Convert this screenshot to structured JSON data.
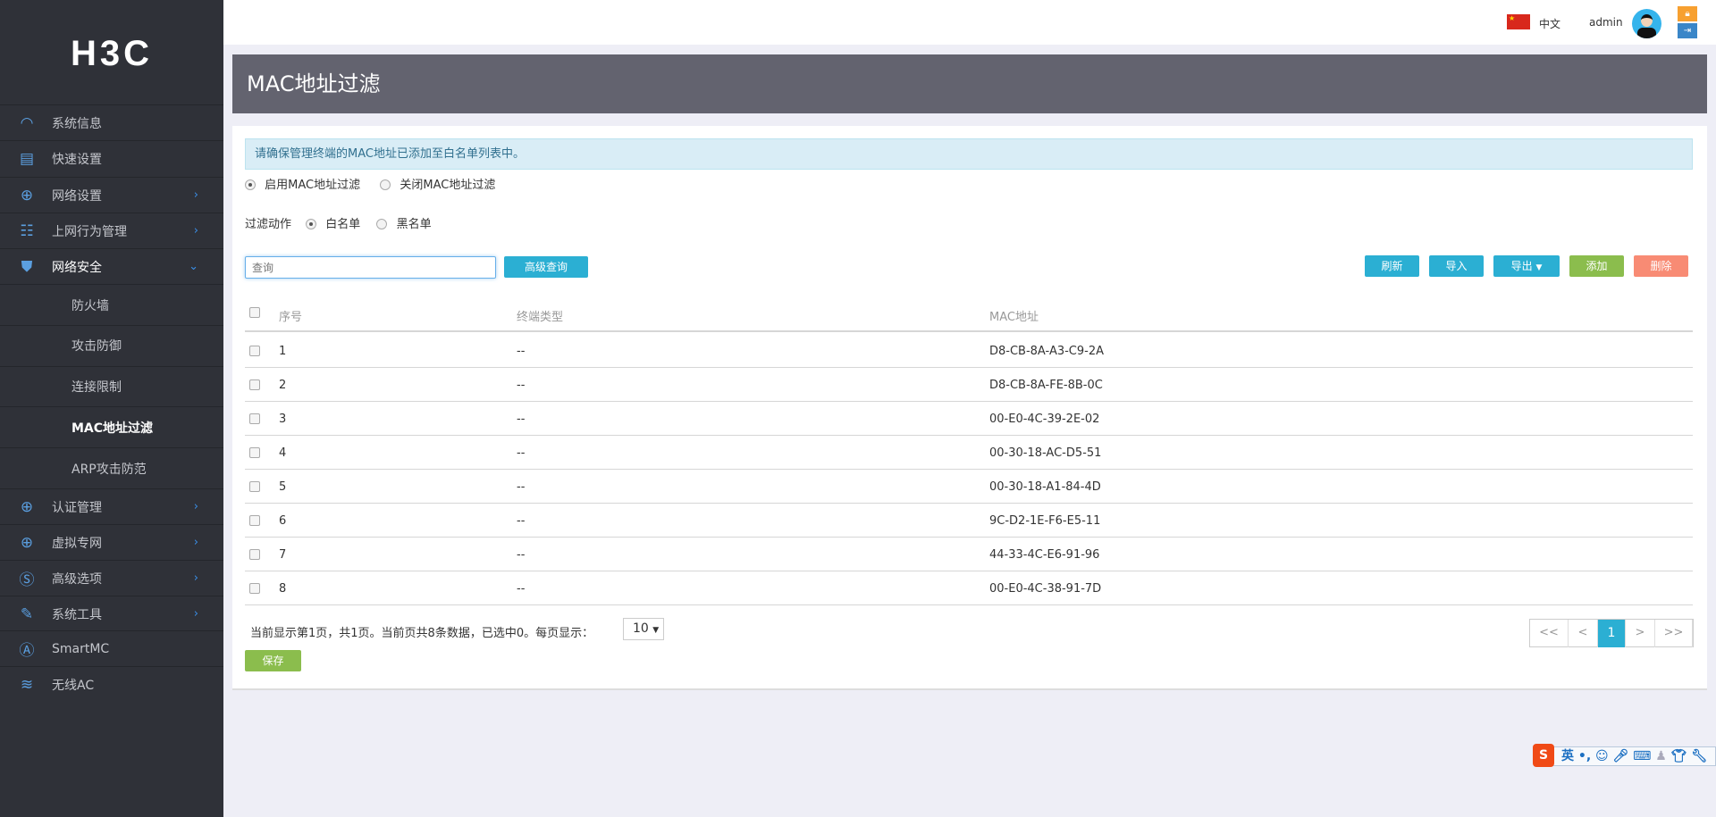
{
  "brand": "H3C",
  "sidebar": {
    "items": [
      {
        "label": "系统信息",
        "icon": "dashboard-icon",
        "glyph": "◠",
        "chev": ""
      },
      {
        "label": "快速设置",
        "icon": "quick-setup-icon",
        "glyph": "▤",
        "chev": ""
      },
      {
        "label": "网络设置",
        "icon": "globe-icon",
        "glyph": "⊕",
        "chev": "›"
      },
      {
        "label": "上网行为管理",
        "icon": "behavior-icon",
        "glyph": "☷",
        "chev": "›"
      },
      {
        "label": "网络安全",
        "icon": "shield-icon",
        "glyph": "⛊",
        "chev": "⌄"
      },
      {
        "label": "认证管理",
        "icon": "globe-icon",
        "glyph": "⊕",
        "chev": "›"
      },
      {
        "label": "虚拟专网",
        "icon": "vpn-icon",
        "glyph": "⊕",
        "chev": "›"
      },
      {
        "label": "高级选项",
        "icon": "advanced-icon",
        "glyph": "Ⓢ",
        "chev": "›"
      },
      {
        "label": "系统工具",
        "icon": "tools-icon",
        "glyph": "✎",
        "chev": "›"
      },
      {
        "label": "SmartMC",
        "icon": "smartmc-icon",
        "glyph": "Ⓐ",
        "chev": ""
      },
      {
        "label": "无线AC",
        "icon": "wifi-icon",
        "glyph": "≋",
        "chev": ""
      }
    ],
    "subitems": [
      "防火墙",
      "攻击防御",
      "连接限制",
      "MAC地址过滤",
      "ARP攻击防范"
    ]
  },
  "topbar": {
    "language": "中文",
    "user": "admin"
  },
  "page": {
    "title": "MAC地址过滤",
    "info": "请确保管理终端的MAC地址已添加至白名单列表中。",
    "enable": "启用MAC地址过滤",
    "disable": "关闭MAC地址过滤",
    "action_label": "过滤动作",
    "whitelist": "白名单",
    "blacklist": "黑名单",
    "search_placeholder": "查询",
    "advanced_search": "高级查询",
    "buttons": {
      "refresh": "刷新",
      "import": "导入",
      "export": "导出",
      "add": "添加",
      "delete": "删除"
    },
    "columns": [
      "序号",
      "终端类型",
      "MAC地址"
    ],
    "rows": [
      [
        "1",
        "--",
        "D8-CB-8A-A3-C9-2A"
      ],
      [
        "2",
        "--",
        "D8-CB-8A-FE-8B-0C"
      ],
      [
        "3",
        "--",
        "00-E0-4C-39-2E-02"
      ],
      [
        "4",
        "--",
        "00-30-18-AC-D5-51"
      ],
      [
        "5",
        "--",
        "00-30-18-A1-84-4D"
      ],
      [
        "6",
        "--",
        "9C-D2-1E-F6-E5-11"
      ],
      [
        "7",
        "--",
        "44-33-4C-E6-91-96"
      ],
      [
        "8",
        "--",
        "00-E0-4C-38-91-7D"
      ]
    ],
    "footer": "当前显示第1页，共1页。当前页共8条数据，已选中0。每页显示：",
    "page_size": "10",
    "save": "保存",
    "pager": [
      "<<",
      "<",
      "1",
      ">",
      ">>"
    ]
  },
  "ime": {
    "lang": "英"
  }
}
